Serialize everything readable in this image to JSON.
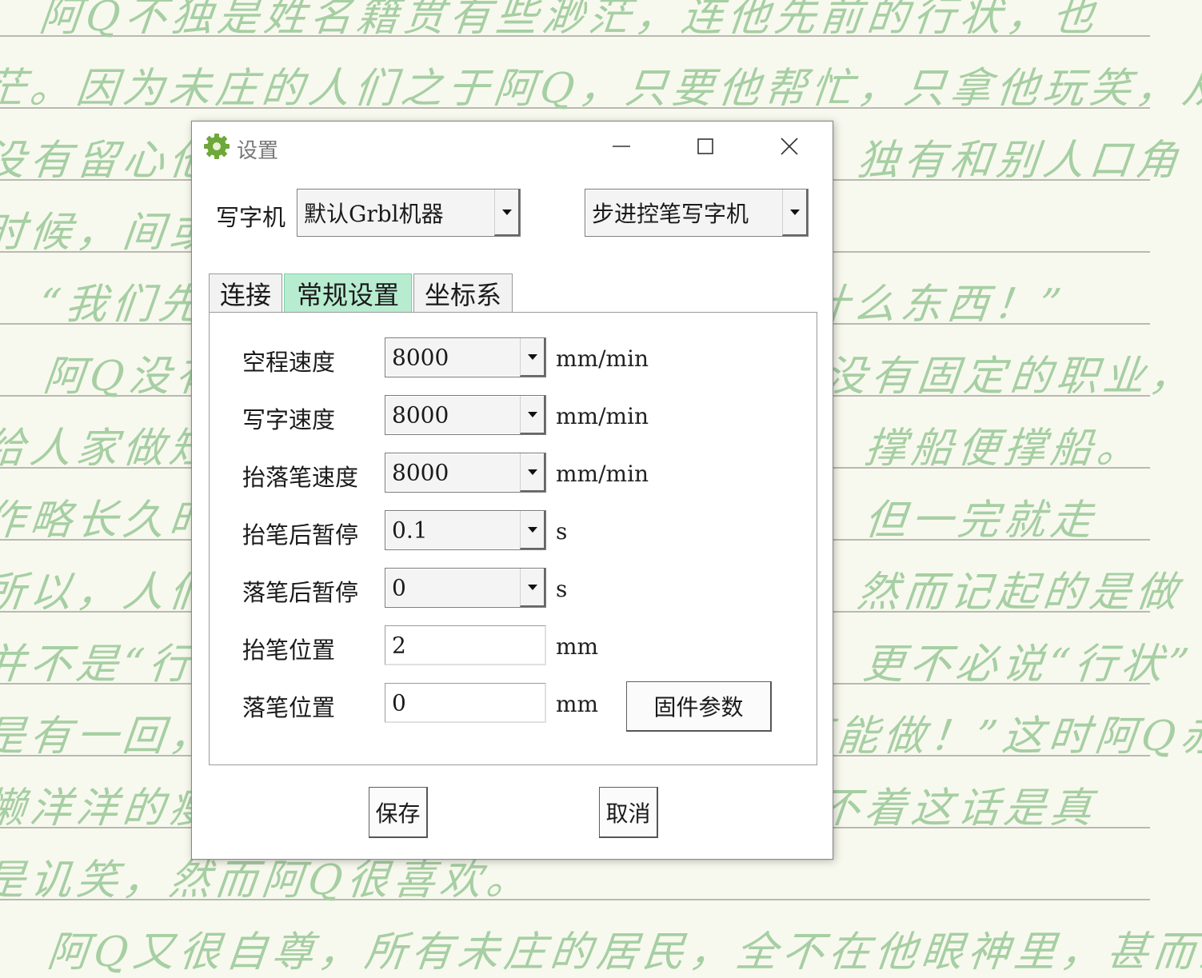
{
  "background": {
    "paper_color": "#f8f9ee",
    "ink_color": "#a6cfa3",
    "lines": [
      "阿Q不独是姓名籍贯有些渺茫，连他先前的行状，也",
      "茫。因为未庄的人们之于阿Q，只要他帮忙，只拿他玩笑，从",
      "没有留心他的行状的。而阿Q自己也不说，独有和别人口角",
      "时候，间或瞪着眼睛道：",
      "“我们先前——比你阔的多啦！你算是什么东西！”",
      "阿Q没有家，住在未庄的土谷祠里；也没有固定的职业，",
      "给人家做短工，割麦便割麦，舂米便舂米，撑船便撑船。",
      "作略长久时，他也或住在临时主人的家里，但一完就走",
      "所以，人们忙碌的时候，也还记起阿Q来，然而记起的是做",
      "并不是“行状”；一闲空，连阿Q都早忘却，更不必说“行状”了。",
      "是有一回，有一个老头子颂扬说：“阿Q真能做！”这时阿Q赤着",
      "懒洋洋的瘦伶仃的正在他面前，别人也摸不着这话是真",
      "是讥笑，然而阿Q很喜欢。",
      "阿Q又很自尊，所有未庄的居民，全不在他眼神里，甚而至"
    ]
  },
  "dialog": {
    "title": "设置",
    "minimize_glyph": "—",
    "maximize_glyph": "☐",
    "close_glyph": "✕",
    "machine_label": "写字机",
    "machine_select": "默认Grbl机器",
    "machine_type_select": "步进控笔写字机",
    "tabs": [
      "连接",
      "常规设置",
      "坐标系"
    ],
    "active_tab": 1,
    "fields": [
      {
        "label": "空程速度",
        "value": "8000",
        "unit": "mm/min",
        "kind": "combo"
      },
      {
        "label": "写字速度",
        "value": "8000",
        "unit": "mm/min",
        "kind": "combo"
      },
      {
        "label": "抬落笔速度",
        "value": "8000",
        "unit": "mm/min",
        "kind": "combo"
      },
      {
        "label": "抬笔后暂停",
        "value": "0.1",
        "unit": "s",
        "kind": "combo"
      },
      {
        "label": "落笔后暂停",
        "value": "0",
        "unit": "s",
        "kind": "combo"
      },
      {
        "label": "抬笔位置",
        "value": "2",
        "unit": "mm",
        "kind": "input"
      },
      {
        "label": "落笔位置",
        "value": "0",
        "unit": "mm",
        "kind": "input"
      }
    ],
    "firmware_button": "固件参数",
    "save_button": "保存",
    "cancel_button": "取消"
  }
}
